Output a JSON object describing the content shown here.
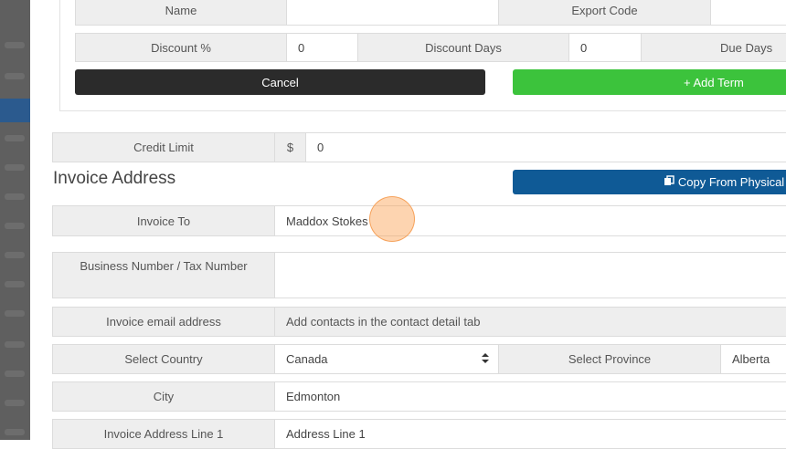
{
  "terms": {
    "name_label": "Name",
    "export_code_label": "Export Code",
    "discount_pct_label": "Discount %",
    "discount_pct_value": "0",
    "discount_days_label": "Discount Days",
    "discount_days_value": "0",
    "due_days_label": "Due Days",
    "cancel_label": "Cancel",
    "add_term_label": "+ Add Term"
  },
  "credit": {
    "label": "Credit Limit",
    "currency": "$",
    "value": "0"
  },
  "invoice_address": {
    "heading": "Invoice Address",
    "copy_button_label": "Copy From Physical Ad",
    "invoice_to_label": "Invoice To",
    "invoice_to_value": "Maddox Stokes",
    "business_number_label": "Business Number / Tax Number",
    "business_number_value": "",
    "email_label": "Invoice email address",
    "email_value": "Add contacts in the contact detail tab",
    "country_label": "Select Country",
    "country_value": "Canada",
    "province_label": "Select Province",
    "province_value": "Alberta",
    "city_label": "City",
    "city_value": "Edmonton",
    "line1_label": "Invoice Address Line 1",
    "line1_placeholder": "Address Line 1"
  },
  "icons": {
    "copy": "copy-icon",
    "sort": "sort-arrows-icon"
  },
  "colors": {
    "cancel": "#2b2b2b",
    "add_term": "#3cc33c",
    "copy_button": "#0f5a96",
    "label_bg": "#eeeeee"
  }
}
